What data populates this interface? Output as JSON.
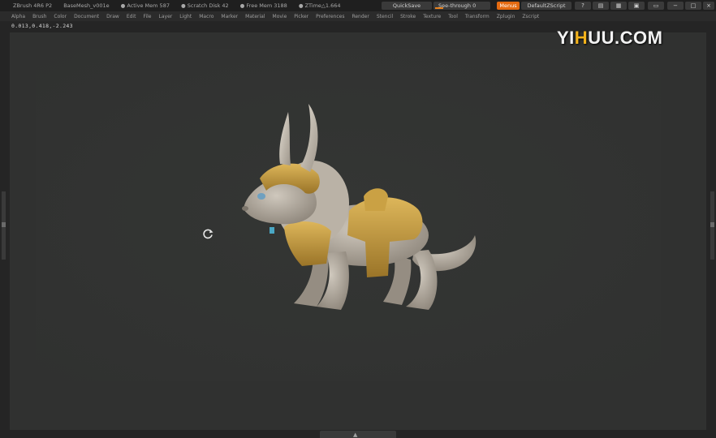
{
  "titlebar": {
    "app": "ZBrush 4R6 P2",
    "file": "BaseMesh_v001e",
    "active_mem": "● Active Mem 587",
    "scratch_disk": "● Scratch Disk 42",
    "free_mem": "● Free Mem 3188",
    "ztime": "● ZTime△1.664"
  },
  "buttons": {
    "quicksave": "QuickSave",
    "seethrough": "See-through   0",
    "menus": "Menus",
    "default_script": "DefaultZScript"
  },
  "menu_items": [
    "Alpha",
    "Brush",
    "Color",
    "Document",
    "Draw",
    "Edit",
    "File",
    "Layer",
    "Light",
    "Macro",
    "Marker",
    "Material",
    "Movie",
    "Picker",
    "Preferences",
    "Render",
    "Stencil",
    "Stroke",
    "Texture",
    "Tool",
    "Transform",
    "Zplugin",
    "Zscript"
  ],
  "coords": "0.013,0.418,-2.243",
  "watermark": {
    "prefix": "YI",
    "accent": "H",
    "suffix": "UU.COM"
  },
  "icons": [
    "help-icon",
    "window-icon",
    "layout-icon",
    "palette-icon",
    "save-icon",
    "minimize-icon",
    "maximize-icon",
    "close-icon"
  ],
  "colors": {
    "accent": "#e46a10",
    "canvas": "#303130",
    "model_fur": "#b2a99d",
    "armor": "#c39a3c"
  }
}
